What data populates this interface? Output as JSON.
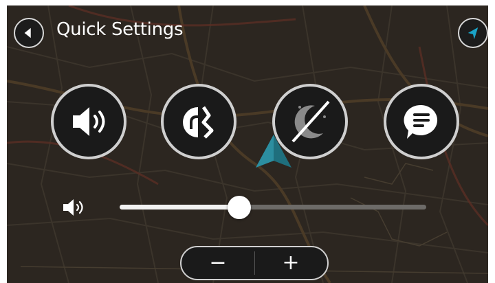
{
  "header": {
    "title": "Quick Settings"
  },
  "icons": {
    "back": "back-arrow-icon",
    "current_location": "navigation-arrow-icon",
    "sound": "speaker-icon",
    "route_options": "route-change-icon",
    "night_mode": "night-mode-icon",
    "voice_instructions": "speech-bubble-icon",
    "volume": "speaker-small-icon"
  },
  "volume": {
    "level": 0.39
  },
  "stepper": {
    "minus_label": "−",
    "plus_label": "+"
  },
  "colors": {
    "accent": "#1aa3c8",
    "map_background": "#2b2520"
  }
}
